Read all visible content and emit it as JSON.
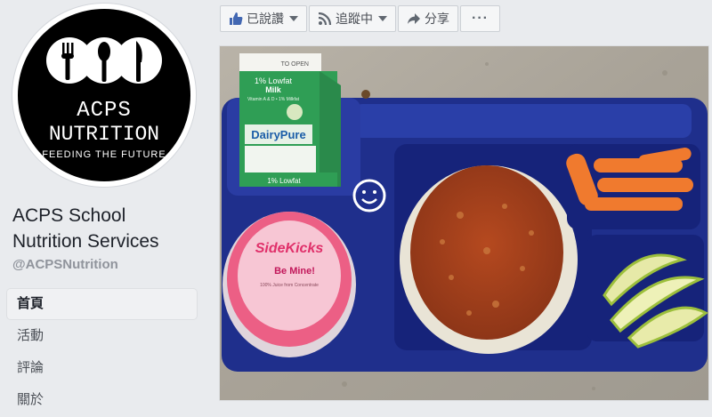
{
  "logo": {
    "line1": "ACPS",
    "line2": "NUTRITION",
    "tagline": "FEEDING THE FUTURE"
  },
  "page": {
    "name_line1": "ACPS School",
    "name_line2": "Nutrition Services",
    "handle": "@ACPSNutrition"
  },
  "nav": [
    {
      "label": "首頁"
    },
    {
      "label": "活動"
    },
    {
      "label": "評論"
    },
    {
      "label": "關於"
    }
  ],
  "actions": {
    "liked": "已說讚",
    "following": "追蹤中",
    "share": "分享"
  },
  "photo": {
    "milk": {
      "top_flap": "TO OPEN",
      "fat": "1% Lowfat",
      "kind": "Milk",
      "vitamins": "Vitamin A & D • 1% Milkfat",
      "brand": "DairyPure",
      "bottom": "1% Lowfat"
    },
    "cup": {
      "brand": "SideKicks",
      "flavor": "Be Mine!",
      "desc": "100% Juice from Concentrate"
    }
  },
  "colors": {
    "accent": "#4267b2",
    "tray": "#1f2f8c",
    "milk_green": "#2f9e55",
    "cup_pink": "#e8557a"
  }
}
